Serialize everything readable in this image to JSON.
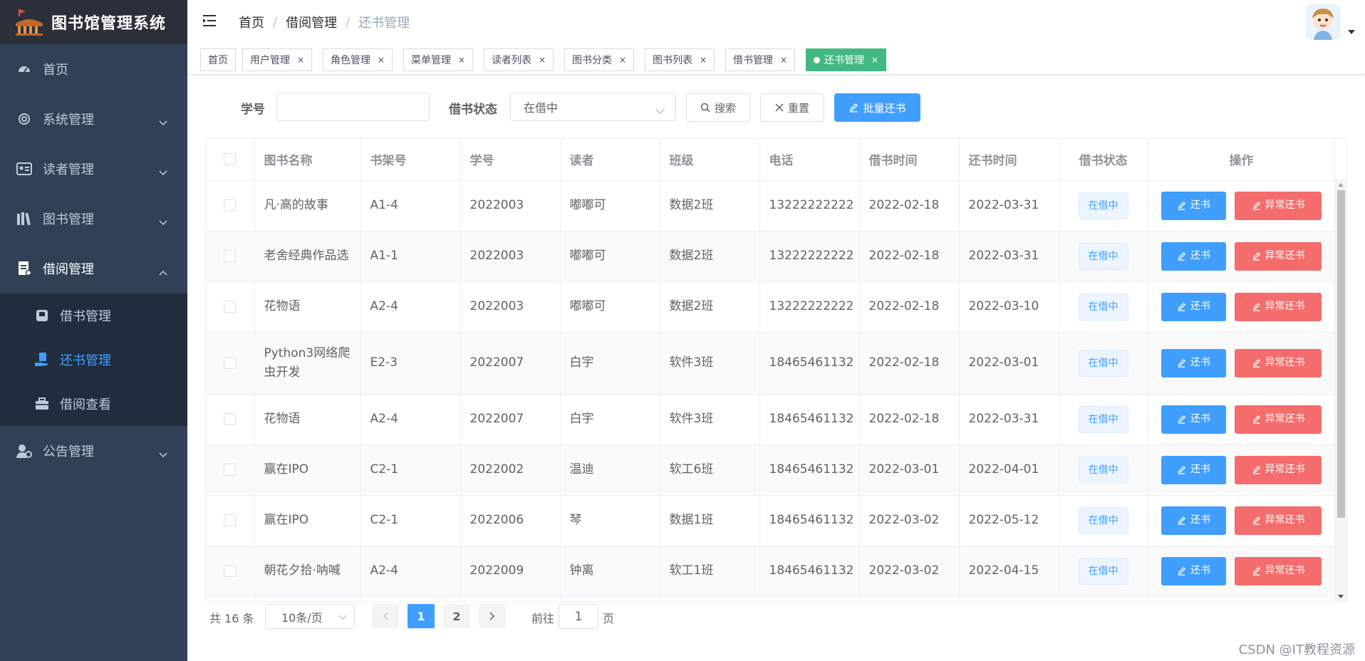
{
  "app": {
    "title": "图书馆管理系统"
  },
  "sidebar": {
    "items": [
      {
        "label": "首页",
        "icon": "dashboard-icon"
      },
      {
        "label": "系统管理",
        "icon": "gear-icon"
      },
      {
        "label": "读者管理",
        "icon": "id-card-icon"
      },
      {
        "label": "图书管理",
        "icon": "books-icon"
      },
      {
        "label": "借阅管理",
        "icon": "document-icon",
        "open": true,
        "children": [
          {
            "label": "借书管理",
            "icon": "book-icon"
          },
          {
            "label": "还书管理",
            "icon": "return-icon",
            "active": true
          },
          {
            "label": "借阅查看",
            "icon": "briefcase-icon"
          }
        ]
      },
      {
        "label": "公告管理",
        "icon": "settings-user-icon"
      }
    ]
  },
  "breadcrumb": [
    "首页",
    "借阅管理",
    "还书管理"
  ],
  "tags": [
    {
      "label": "首页",
      "closable": false
    },
    {
      "label": "用户管理",
      "closable": true
    },
    {
      "label": "角色管理",
      "closable": true
    },
    {
      "label": "菜单管理",
      "closable": true
    },
    {
      "label": "读者列表",
      "closable": true
    },
    {
      "label": "图书分类",
      "closable": true
    },
    {
      "label": "图书列表",
      "closable": true
    },
    {
      "label": "借书管理",
      "closable": true
    },
    {
      "label": "还书管理",
      "closable": true,
      "active": true
    }
  ],
  "tag_close": "×",
  "search": {
    "student_id_label": "学号",
    "student_id_value": "",
    "status_label": "借书状态",
    "status_value": "在借中",
    "search_button": "搜索",
    "reset_button": "重置",
    "batch_return_button": "批量还书"
  },
  "table": {
    "columns": [
      "图书名称",
      "书架号",
      "学号",
      "读者",
      "班级",
      "电话",
      "借书时间",
      "还书时间",
      "借书状态",
      "操作"
    ],
    "rows": [
      {
        "book": "凡·高的故事",
        "shelf": "A1-4",
        "student_id": "2022003",
        "reader": "嘟嘟可",
        "class": "数据2班",
        "phone": "13222222222",
        "borrow_time": "2022-02-18",
        "return_time": "2022-03-31",
        "status": "在借中"
      },
      {
        "book": "老舍经典作品选",
        "shelf": "A1-1",
        "student_id": "2022003",
        "reader": "嘟嘟可",
        "class": "数据2班",
        "phone": "13222222222",
        "borrow_time": "2022-02-18",
        "return_time": "2022-03-31",
        "status": "在借中"
      },
      {
        "book": "花物语",
        "shelf": "A2-4",
        "student_id": "2022003",
        "reader": "嘟嘟可",
        "class": "数据2班",
        "phone": "13222222222",
        "borrow_time": "2022-02-18",
        "return_time": "2022-03-10",
        "status": "在借中"
      },
      {
        "book": "Python3网络爬虫开发",
        "shelf": "E2-3",
        "student_id": "2022007",
        "reader": "白宇",
        "class": "软件3班",
        "phone": "18465461132",
        "borrow_time": "2022-02-18",
        "return_time": "2022-03-01",
        "status": "在借中"
      },
      {
        "book": "花物语",
        "shelf": "A2-4",
        "student_id": "2022007",
        "reader": "白宇",
        "class": "软件3班",
        "phone": "18465461132",
        "borrow_time": "2022-02-18",
        "return_time": "2022-03-31",
        "status": "在借中"
      },
      {
        "book": "赢在IPO",
        "shelf": "C2-1",
        "student_id": "2022002",
        "reader": "温迪",
        "class": "软工6班",
        "phone": "18465461132",
        "borrow_time": "2022-03-01",
        "return_time": "2022-04-01",
        "status": "在借中"
      },
      {
        "book": "赢在IPO",
        "shelf": "C2-1",
        "student_id": "2022006",
        "reader": "琴",
        "class": "数据1班",
        "phone": "18465461132",
        "borrow_time": "2022-03-02",
        "return_time": "2022-05-12",
        "status": "在借中"
      },
      {
        "book": "朝花夕拾·呐喊",
        "shelf": "A2-4",
        "student_id": "2022009",
        "reader": "钟离",
        "class": "软工1班",
        "phone": "18465461132",
        "borrow_time": "2022-03-02",
        "return_time": "2022-04-15",
        "status": "在借中"
      }
    ],
    "actions": {
      "return_label": "还书",
      "abnormal_label": "异常还书"
    }
  },
  "pagination": {
    "total_text": "共 16 条",
    "page_size": "10条/页",
    "pages": [
      "1",
      "2"
    ],
    "current_page": "1",
    "goto_prefix": "前往",
    "goto_value": "1",
    "goto_suffix": "页"
  },
  "watermark": "CSDN @IT教程资源",
  "colors": {
    "primary": "#409eff",
    "danger": "#f56c6c",
    "sidebar": "#304156",
    "active_tag": "#42b983"
  }
}
